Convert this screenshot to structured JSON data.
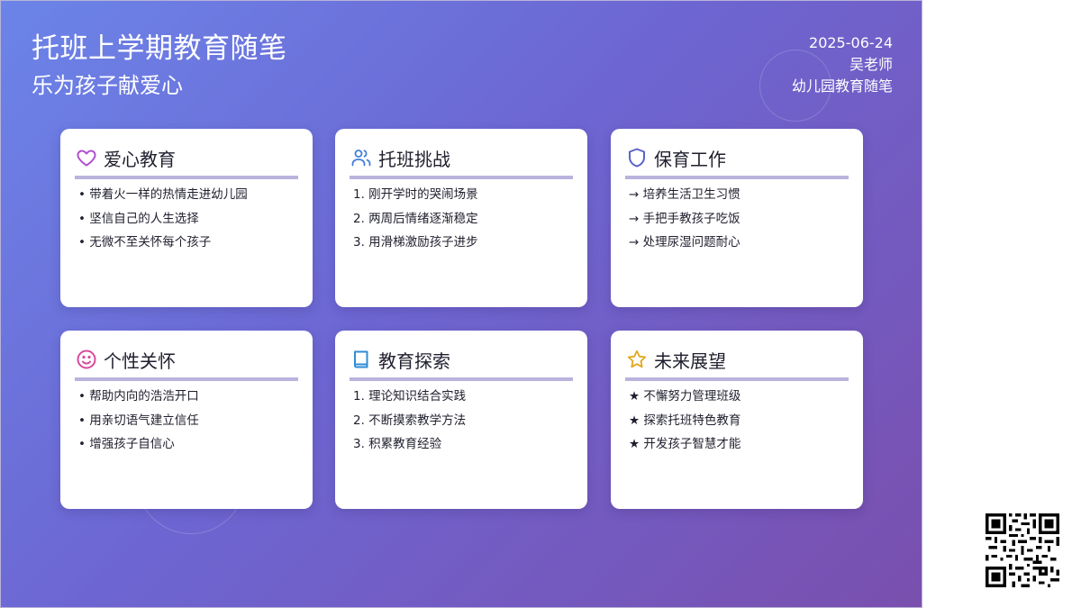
{
  "header": {
    "title": "托班上学期教育随笔",
    "subtitle": "乐为孩子献爱心",
    "date": "2025-06-24",
    "author": "吴老师",
    "category": "幼儿园教育随笔"
  },
  "cards": [
    {
      "title": "爱心教育",
      "icon": "heart-icon",
      "icon_color": "#b04fd0",
      "list_style": "bullet",
      "items": [
        "带着火一样的热情走进幼儿园",
        "坚信自己的人生选择",
        "无微不至关怀每个孩子"
      ]
    },
    {
      "title": "托班挑战",
      "icon": "users-icon",
      "icon_color": "#3f7fd8",
      "list_style": "numbered",
      "items": [
        "刚开学时的哭闹场景",
        "两周后情绪逐渐稳定",
        "用滑梯激励孩子进步"
      ]
    },
    {
      "title": "保育工作",
      "icon": "shield-icon",
      "icon_color": "#5a63c8",
      "list_style": "arrow",
      "items": [
        "培养生活卫生习惯",
        "手把手教孩子吃饭",
        "处理尿湿问题耐心"
      ]
    },
    {
      "title": "个性关怀",
      "icon": "smile-icon",
      "icon_color": "#d84a9a",
      "list_style": "bullet",
      "items": [
        "帮助内向的浩浩开口",
        "用亲切语气建立信任",
        "增强孩子自信心"
      ]
    },
    {
      "title": "教育探索",
      "icon": "book-icon",
      "icon_color": "#2f8cd6",
      "list_style": "numbered",
      "items": [
        "理论知识结合实践",
        "不断摸索教学方法",
        "积累教育经验"
      ]
    },
    {
      "title": "未来展望",
      "icon": "star-icon",
      "icon_color": "#e0a81c",
      "list_style": "star",
      "items": [
        "不懈努力管理班级",
        "探索托班特色教育",
        "开发孩子智慧才能"
      ]
    }
  ],
  "qr_code": {
    "icon": "qr-code-icon"
  }
}
